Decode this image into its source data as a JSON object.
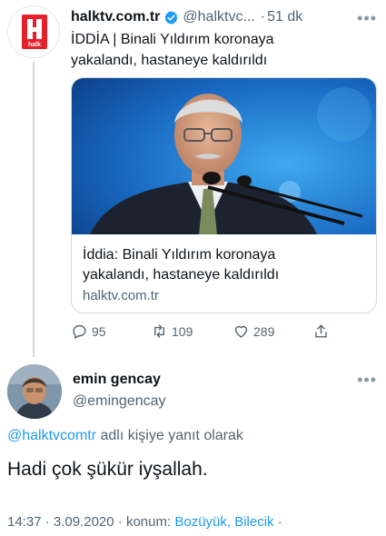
{
  "original_tweet": {
    "display_name": "halktv.com.tr",
    "handle": "@halktvc...",
    "separator": "·",
    "time": "51 dk",
    "more_icon": "more-horizontal-icon",
    "text_line1": "İDDİA | Binali Yıldırım koronaya",
    "text_line2": "yakalandı, hastaneye kaldırıldı",
    "logo_text": "halk",
    "card": {
      "title_line1": "İddia: Binali Yıldırım koronaya",
      "title_line2": "yakalandı, hastaneye kaldırıldı",
      "domain": "halktv.com.tr"
    },
    "actions": {
      "replies": "95",
      "retweets": "109",
      "likes": "289"
    }
  },
  "reply": {
    "display_name": "emin gencay",
    "handle": "@emingencay",
    "replying_mention": "@halktvcomtr",
    "replying_suffix": " adlı kişiye yanıt olarak",
    "text": "Hadi çok şükür iyşallah.",
    "time": "14:37",
    "date": "3.09.2020",
    "location_label": "konum:",
    "location": "Bozüyük, Bilecik",
    "sep": " · "
  },
  "colors": {
    "brand_red": "#e4202a",
    "link_blue": "#1d9bf0",
    "muted": "#536471"
  }
}
